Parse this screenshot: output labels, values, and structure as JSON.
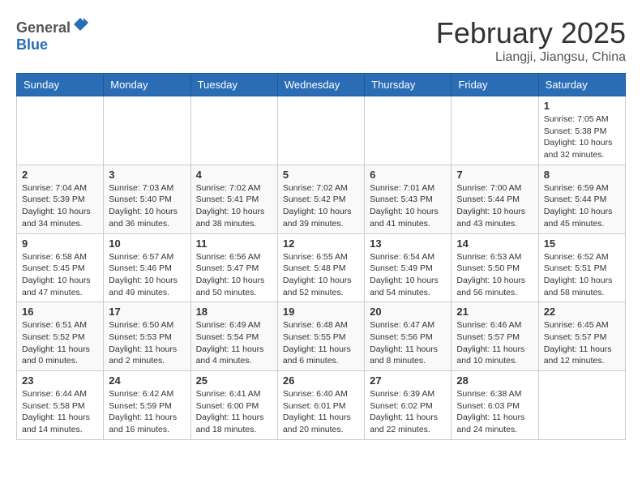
{
  "header": {
    "logo": {
      "text_general": "General",
      "text_blue": "Blue"
    },
    "title": "February 2025",
    "subtitle": "Liangji, Jiangsu, China"
  },
  "calendar": {
    "days_of_week": [
      "Sunday",
      "Monday",
      "Tuesday",
      "Wednesday",
      "Thursday",
      "Friday",
      "Saturday"
    ],
    "weeks": [
      [
        {
          "day": "",
          "info": ""
        },
        {
          "day": "",
          "info": ""
        },
        {
          "day": "",
          "info": ""
        },
        {
          "day": "",
          "info": ""
        },
        {
          "day": "",
          "info": ""
        },
        {
          "day": "",
          "info": ""
        },
        {
          "day": "1",
          "info": "Sunrise: 7:05 AM\nSunset: 5:38 PM\nDaylight: 10 hours and 32 minutes."
        }
      ],
      [
        {
          "day": "2",
          "info": "Sunrise: 7:04 AM\nSunset: 5:39 PM\nDaylight: 10 hours and 34 minutes."
        },
        {
          "day": "3",
          "info": "Sunrise: 7:03 AM\nSunset: 5:40 PM\nDaylight: 10 hours and 36 minutes."
        },
        {
          "day": "4",
          "info": "Sunrise: 7:02 AM\nSunset: 5:41 PM\nDaylight: 10 hours and 38 minutes."
        },
        {
          "day": "5",
          "info": "Sunrise: 7:02 AM\nSunset: 5:42 PM\nDaylight: 10 hours and 39 minutes."
        },
        {
          "day": "6",
          "info": "Sunrise: 7:01 AM\nSunset: 5:43 PM\nDaylight: 10 hours and 41 minutes."
        },
        {
          "day": "7",
          "info": "Sunrise: 7:00 AM\nSunset: 5:44 PM\nDaylight: 10 hours and 43 minutes."
        },
        {
          "day": "8",
          "info": "Sunrise: 6:59 AM\nSunset: 5:44 PM\nDaylight: 10 hours and 45 minutes."
        }
      ],
      [
        {
          "day": "9",
          "info": "Sunrise: 6:58 AM\nSunset: 5:45 PM\nDaylight: 10 hours and 47 minutes."
        },
        {
          "day": "10",
          "info": "Sunrise: 6:57 AM\nSunset: 5:46 PM\nDaylight: 10 hours and 49 minutes."
        },
        {
          "day": "11",
          "info": "Sunrise: 6:56 AM\nSunset: 5:47 PM\nDaylight: 10 hours and 50 minutes."
        },
        {
          "day": "12",
          "info": "Sunrise: 6:55 AM\nSunset: 5:48 PM\nDaylight: 10 hours and 52 minutes."
        },
        {
          "day": "13",
          "info": "Sunrise: 6:54 AM\nSunset: 5:49 PM\nDaylight: 10 hours and 54 minutes."
        },
        {
          "day": "14",
          "info": "Sunrise: 6:53 AM\nSunset: 5:50 PM\nDaylight: 10 hours and 56 minutes."
        },
        {
          "day": "15",
          "info": "Sunrise: 6:52 AM\nSunset: 5:51 PM\nDaylight: 10 hours and 58 minutes."
        }
      ],
      [
        {
          "day": "16",
          "info": "Sunrise: 6:51 AM\nSunset: 5:52 PM\nDaylight: 11 hours and 0 minutes."
        },
        {
          "day": "17",
          "info": "Sunrise: 6:50 AM\nSunset: 5:53 PM\nDaylight: 11 hours and 2 minutes."
        },
        {
          "day": "18",
          "info": "Sunrise: 6:49 AM\nSunset: 5:54 PM\nDaylight: 11 hours and 4 minutes."
        },
        {
          "day": "19",
          "info": "Sunrise: 6:48 AM\nSunset: 5:55 PM\nDaylight: 11 hours and 6 minutes."
        },
        {
          "day": "20",
          "info": "Sunrise: 6:47 AM\nSunset: 5:56 PM\nDaylight: 11 hours and 8 minutes."
        },
        {
          "day": "21",
          "info": "Sunrise: 6:46 AM\nSunset: 5:57 PM\nDaylight: 11 hours and 10 minutes."
        },
        {
          "day": "22",
          "info": "Sunrise: 6:45 AM\nSunset: 5:57 PM\nDaylight: 11 hours and 12 minutes."
        }
      ],
      [
        {
          "day": "23",
          "info": "Sunrise: 6:44 AM\nSunset: 5:58 PM\nDaylight: 11 hours and 14 minutes."
        },
        {
          "day": "24",
          "info": "Sunrise: 6:42 AM\nSunset: 5:59 PM\nDaylight: 11 hours and 16 minutes."
        },
        {
          "day": "25",
          "info": "Sunrise: 6:41 AM\nSunset: 6:00 PM\nDaylight: 11 hours and 18 minutes."
        },
        {
          "day": "26",
          "info": "Sunrise: 6:40 AM\nSunset: 6:01 PM\nDaylight: 11 hours and 20 minutes."
        },
        {
          "day": "27",
          "info": "Sunrise: 6:39 AM\nSunset: 6:02 PM\nDaylight: 11 hours and 22 minutes."
        },
        {
          "day": "28",
          "info": "Sunrise: 6:38 AM\nSunset: 6:03 PM\nDaylight: 11 hours and 24 minutes."
        },
        {
          "day": "",
          "info": ""
        }
      ]
    ]
  }
}
